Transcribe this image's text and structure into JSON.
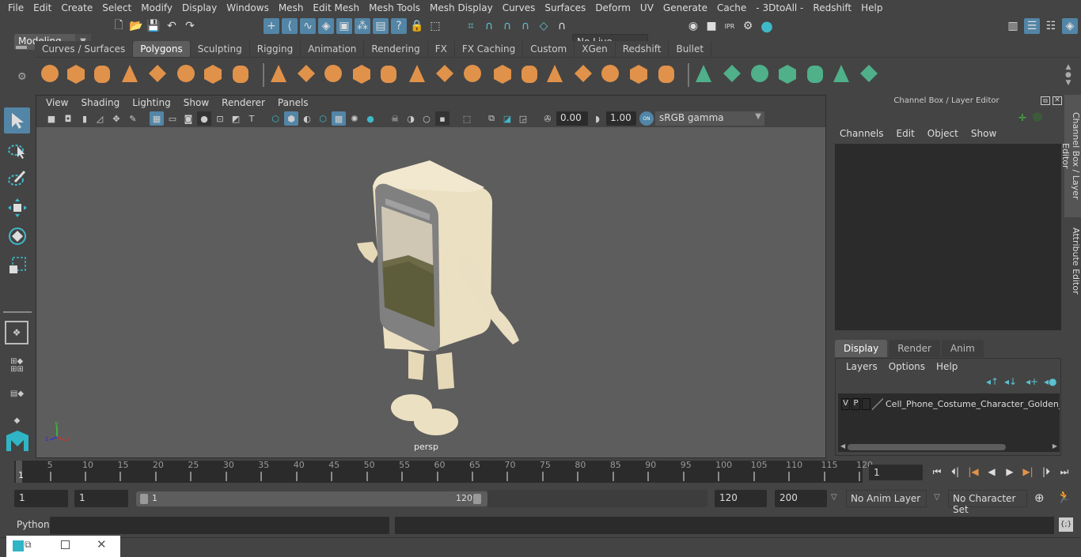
{
  "menubar": [
    "File",
    "Edit",
    "Create",
    "Select",
    "Modify",
    "Display",
    "Windows",
    "Mesh",
    "Edit Mesh",
    "Mesh Tools",
    "Mesh Display",
    "Curves",
    "Surfaces",
    "Deform",
    "UV",
    "Generate",
    "Cache",
    "- 3DtoAll -",
    "Redshift",
    "Help"
  ],
  "statusline": {
    "workspace": "Modeling",
    "live_surface": "No Live Surface"
  },
  "shelf": {
    "tabs": [
      "Curves / Surfaces",
      "Polygons",
      "Sculpting",
      "Rigging",
      "Animation",
      "Rendering",
      "FX",
      "FX Caching",
      "Custom",
      "XGen",
      "Redshift",
      "Bullet"
    ],
    "active_tab": "Polygons"
  },
  "viewport": {
    "menu": [
      "View",
      "Shading",
      "Lighting",
      "Show",
      "Renderer",
      "Panels"
    ],
    "exposure": "0.00",
    "gamma": "1.00",
    "color_space": "sRGB gamma",
    "camera_label": "persp",
    "axis": {
      "x": "x",
      "y": "y",
      "z": "z"
    }
  },
  "channel_box": {
    "title": "Channel Box / Layer Editor",
    "menu": [
      "Channels",
      "Edit",
      "Object",
      "Show"
    ]
  },
  "layer_editor": {
    "tabs": [
      "Display",
      "Render",
      "Anim"
    ],
    "active_tab": "Display",
    "menu": [
      "Layers",
      "Options",
      "Help"
    ],
    "layers": [
      {
        "v": "V",
        "p": "P",
        "name": "Cell_Phone_Costume_Character_Golden_A_"
      }
    ]
  },
  "side_tabs": [
    "Channel Box / Layer Editor",
    "Attribute Editor"
  ],
  "timeline": {
    "ticks": [
      5,
      10,
      15,
      20,
      25,
      30,
      35,
      40,
      45,
      50,
      55,
      60,
      65,
      70,
      75,
      80,
      85,
      90,
      95,
      100,
      105,
      110,
      115,
      120
    ],
    "start": 1,
    "end": 120,
    "current_frame_marker": "1",
    "current_frame": "1"
  },
  "range": {
    "start_field": "1",
    "playback_start": "1",
    "range_start_label": "1",
    "range_end_label": "120",
    "playback_end": "120",
    "end_field": "200",
    "anim_layer": "No Anim Layer",
    "character_set": "No Character Set"
  },
  "cmdline": {
    "language": "Python",
    "input": "",
    "output": ""
  },
  "colors": {
    "accent": "#5285a6",
    "shelf_orange": "#e0924a",
    "shelf_green": "#4fb08a",
    "teal": "#3fb8c8"
  }
}
